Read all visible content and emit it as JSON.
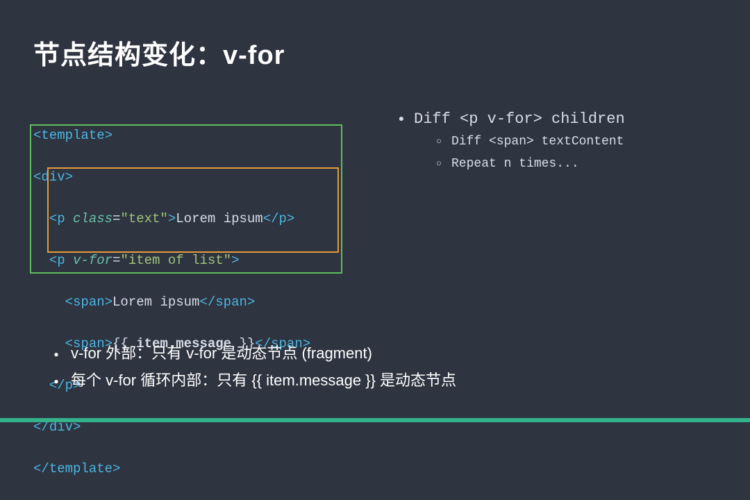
{
  "title": "节点结构变化：v-for",
  "code": {
    "l1": [
      {
        "t": "<",
        "c": "c-tag"
      },
      {
        "t": "template",
        "c": "c-tag"
      },
      {
        "t": ">",
        "c": "c-tag"
      }
    ],
    "l2": [
      {
        "t": "<",
        "c": "c-tag"
      },
      {
        "t": "div",
        "c": "c-tag"
      },
      {
        "t": ">",
        "c": "c-tag"
      }
    ],
    "l3": [
      {
        "t": "  ",
        "c": ""
      },
      {
        "t": "<",
        "c": "c-tag"
      },
      {
        "t": "p",
        "c": "c-tag"
      },
      {
        "t": " ",
        "c": ""
      },
      {
        "t": "class",
        "c": "c-attr"
      },
      {
        "t": "=",
        "c": "c-txt"
      },
      {
        "t": "\"text\"",
        "c": "c-str"
      },
      {
        "t": ">",
        "c": "c-tag"
      },
      {
        "t": "Lorem ipsum",
        "c": "c-txt"
      },
      {
        "t": "</",
        "c": "c-tag"
      },
      {
        "t": "p",
        "c": "c-tag"
      },
      {
        "t": ">",
        "c": "c-tag"
      }
    ],
    "l4": [
      {
        "t": "  ",
        "c": ""
      },
      {
        "t": "<",
        "c": "c-tag"
      },
      {
        "t": "p",
        "c": "c-tag"
      },
      {
        "t": " ",
        "c": ""
      },
      {
        "t": "v-for",
        "c": "c-attr"
      },
      {
        "t": "=",
        "c": "c-txt"
      },
      {
        "t": "\"item of list\"",
        "c": "c-str"
      },
      {
        "t": ">",
        "c": "c-tag"
      }
    ],
    "l5": [
      {
        "t": "    ",
        "c": ""
      },
      {
        "t": "<",
        "c": "c-tag"
      },
      {
        "t": "span",
        "c": "c-tag"
      },
      {
        "t": ">",
        "c": "c-tag"
      },
      {
        "t": "Lorem ipsum",
        "c": "c-txt"
      },
      {
        "t": "</",
        "c": "c-tag"
      },
      {
        "t": "span",
        "c": "c-tag"
      },
      {
        "t": ">",
        "c": "c-tag"
      }
    ],
    "l6": [
      {
        "t": "    ",
        "c": ""
      },
      {
        "t": "<",
        "c": "c-tag"
      },
      {
        "t": "span",
        "c": "c-tag"
      },
      {
        "t": ">",
        "c": "c-tag"
      },
      {
        "t": "{{ ",
        "c": "c-txt"
      },
      {
        "t": "item.message",
        "c": "c-var"
      },
      {
        "t": " }}",
        "c": "c-txt"
      },
      {
        "t": "</",
        "c": "c-tag"
      },
      {
        "t": "span",
        "c": "c-tag"
      },
      {
        "t": ">",
        "c": "c-tag"
      }
    ],
    "l7": [
      {
        "t": "  ",
        "c": ""
      },
      {
        "t": "</",
        "c": "c-tag"
      },
      {
        "t": "p",
        "c": "c-tag"
      },
      {
        "t": ">",
        "c": "c-tag"
      }
    ],
    "l8": [
      {
        "t": "</",
        "c": "c-tag"
      },
      {
        "t": "div",
        "c": "c-tag"
      },
      {
        "t": ">",
        "c": "c-tag"
      }
    ],
    "l9": [
      {
        "t": "</",
        "c": "c-tag"
      },
      {
        "t": "template",
        "c": "c-tag"
      },
      {
        "t": ">",
        "c": "c-tag"
      }
    ]
  },
  "bullets": {
    "b0": "Diff <p v-for> children",
    "b1": "Diff <span> textContent",
    "b2": "Repeat n times..."
  },
  "footer": {
    "f0": "v-for 外部：只有 v-for 是动态节点 (fragment)",
    "f1": "每个 v-for 循环内部：只有 {{ item.message }} 是动态节点"
  }
}
